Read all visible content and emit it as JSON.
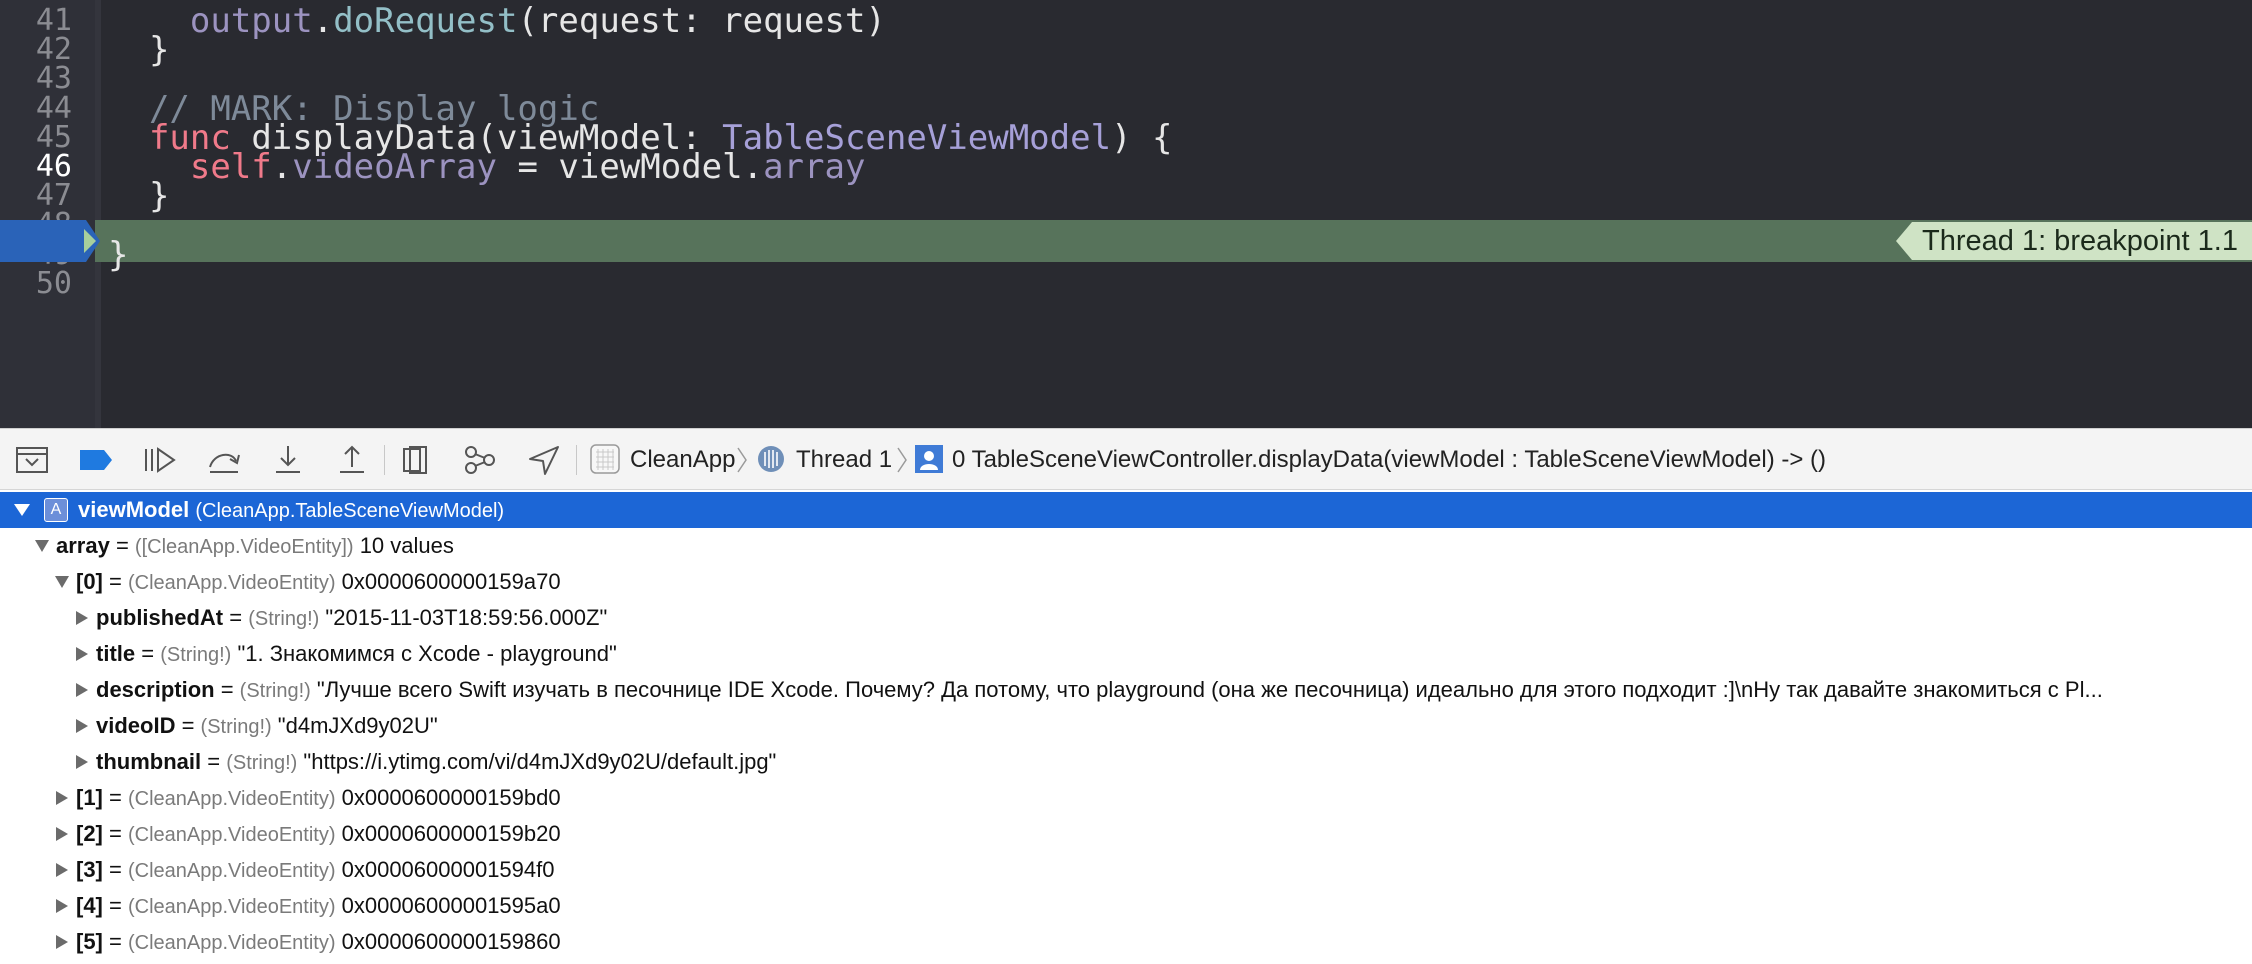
{
  "editor": {
    "lines": [
      {
        "num": "41",
        "tokens": [
          {
            "t": "    "
          },
          {
            "t": "output",
            "c": "prop"
          },
          {
            "t": "."
          },
          {
            "t": "doRequest",
            "c": "method"
          },
          {
            "t": "(request: request)"
          }
        ]
      },
      {
        "num": "42",
        "tokens": [
          {
            "t": "  }"
          }
        ]
      },
      {
        "num": "43",
        "tokens": []
      },
      {
        "num": "44",
        "tokens": [
          {
            "t": "  "
          },
          {
            "t": "// MARK: Display logic",
            "c": "cmt"
          }
        ]
      },
      {
        "num": "45",
        "tokens": [
          {
            "t": "  "
          },
          {
            "t": "func",
            "c": "kw"
          },
          {
            "t": " displayData(viewModel: "
          },
          {
            "t": "TableSceneViewModel",
            "c": "type"
          },
          {
            "t": ") {"
          }
        ]
      },
      {
        "num": "46",
        "tokens": [
          {
            "t": "    "
          },
          {
            "t": "self",
            "c": "kw"
          },
          {
            "t": "."
          },
          {
            "t": "videoArray",
            "c": "prop"
          },
          {
            "t": " = viewModel."
          },
          {
            "t": "array",
            "c": "prop"
          }
        ]
      },
      {
        "num": "47",
        "tokens": [
          {
            "t": "  }"
          }
        ]
      },
      {
        "num": "48",
        "tokens": []
      },
      {
        "num": "49",
        "tokens": [
          {
            "t": "}"
          }
        ]
      },
      {
        "num": "50",
        "tokens": []
      }
    ],
    "current_line": "46",
    "breakpoint_label": "Thread 1: breakpoint 1.1"
  },
  "debug_bar": {
    "buttons": [
      "hide-debug-area",
      "breakpoints-toggle",
      "continue",
      "step-over",
      "step-into",
      "step-out",
      "debug-view-hierarchy",
      "memory-graph",
      "simulate-location"
    ],
    "breadcrumbs": [
      {
        "icon": "app-icon",
        "label": "CleanApp"
      },
      {
        "icon": "thread-icon",
        "label": "Thread 1"
      },
      {
        "icon": "frame-icon",
        "label": "0 TableSceneViewController.displayData(viewModel : TableSceneViewModel) -> ()"
      }
    ]
  },
  "variables": {
    "root": {
      "badge": "A",
      "name": "viewModel",
      "type": "(CleanApp.TableSceneViewModel)"
    },
    "rows": [
      {
        "name": "array",
        "type": "([CleanApp.VideoEntity])",
        "value": "10 values",
        "expanded": true
      },
      {
        "name": "[0]",
        "type": "(CleanApp.VideoEntity)",
        "value": "0x0000600000159a70",
        "expanded": true
      },
      {
        "name": "publishedAt",
        "type": "(String!)",
        "value": "\"2015-11-03T18:59:56.000Z\"",
        "expanded": false
      },
      {
        "name": "title",
        "type": "(String!)",
        "value": "\"1. Знакомимся с Xcode - playground\"",
        "expanded": false
      },
      {
        "name": "description",
        "type": "(String!)",
        "value": "\"Лучше всего Swift изучать в песочнице IDE Xcode. Почему? Да потому, что playground (она же песочница) идеально для этого подходит :]\\nНу так давайте знакомиться с Pl...",
        "expanded": false
      },
      {
        "name": "videoID",
        "type": "(String!)",
        "value": "\"d4mJXd9y02U\"",
        "expanded": false
      },
      {
        "name": "thumbnail",
        "type": "(String!)",
        "value": "\"https://i.ytimg.com/vi/d4mJXd9y02U/default.jpg\"",
        "expanded": false
      },
      {
        "name": "[1]",
        "type": "(CleanApp.VideoEntity)",
        "value": "0x0000600000159bd0",
        "expanded": false
      },
      {
        "name": "[2]",
        "type": "(CleanApp.VideoEntity)",
        "value": "0x0000600000159b20",
        "expanded": false
      },
      {
        "name": "[3]",
        "type": "(CleanApp.VideoEntity)",
        "value": "0x00006000001594f0",
        "expanded": false
      },
      {
        "name": "[4]",
        "type": "(CleanApp.VideoEntity)",
        "value": "0x00006000001595a0",
        "expanded": false
      },
      {
        "name": "[5]",
        "type": "(CleanApp.VideoEntity)",
        "value": "0x0000600000159860",
        "expanded": false
      }
    ]
  },
  "colors": {
    "editor_bg": "#292a30",
    "breakpoint_line": "#57735b",
    "breakpoint_badge": "#cfe3c5",
    "selection": "#1c66d6",
    "accent_blue": "#1f7ae0"
  }
}
